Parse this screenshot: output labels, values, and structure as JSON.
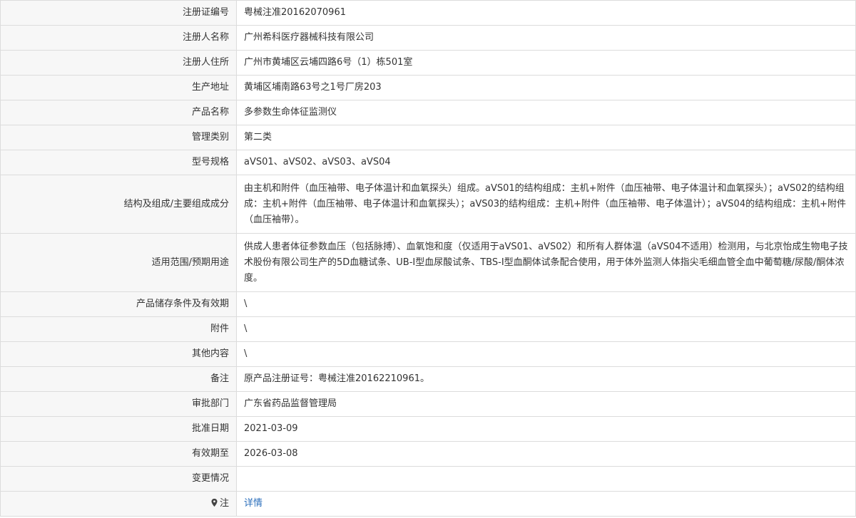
{
  "rows": [
    {
      "label": "注册证编号",
      "value": "粤械注准20162070961"
    },
    {
      "label": "注册人名称",
      "value": "广州希科医疗器械科技有限公司"
    },
    {
      "label": "注册人住所",
      "value": "广州市黄埔区云埔四路6号（1）栋501室"
    },
    {
      "label": "生产地址",
      "value": "黄埔区埔南路63号之1号厂房203"
    },
    {
      "label": "产品名称",
      "value": "多参数生命体征监测仪"
    },
    {
      "label": "管理类别",
      "value": "第二类"
    },
    {
      "label": "型号规格",
      "value": "aVS01、aVS02、aVS03、aVS04"
    },
    {
      "label": "结构及组成/主要组成成分",
      "value": "由主机和附件（血压袖带、电子体温计和血氧探头）组成。aVS01的结构组成：主机+附件（血压袖带、电子体温计和血氧探头）；aVS02的结构组成：主机+附件（血压袖带、电子体温计和血氧探头）；aVS03的结构组成：主机+附件（血压袖带、电子体温计）；aVS04的结构组成：主机+附件（血压袖带）。"
    },
    {
      "label": "适用范围/预期用途",
      "value": "供成人患者体征参数血压（包括脉搏）、血氧饱和度（仅适用于aVS01、aVS02）和所有人群体温（aVS04不适用）检测用，与北京怡成生物电子技术股份有限公司生产的5D血糖试条、UB-I型血尿酸试条、TBS-I型血酮体试条配合使用，用于体外监测人体指尖毛细血管全血中葡萄糖/尿酸/酮体浓度。"
    },
    {
      "label": "产品储存条件及有效期",
      "value": "\\"
    },
    {
      "label": "附件",
      "value": "\\"
    },
    {
      "label": "其他内容",
      "value": "\\"
    },
    {
      "label": "备注",
      "value": "原产品注册证号：粤械注准20162210961。"
    },
    {
      "label": "审批部门",
      "value": "广东省药品监督管理局"
    },
    {
      "label": "批准日期",
      "value": "2021-03-09"
    },
    {
      "label": "有效期至",
      "value": "2026-03-08"
    },
    {
      "label": "变更情况",
      "value": ""
    }
  ],
  "note": {
    "label": "注",
    "icon": "map-pin-icon",
    "link_text": "详情",
    "link_color": "#2a6ebb"
  }
}
